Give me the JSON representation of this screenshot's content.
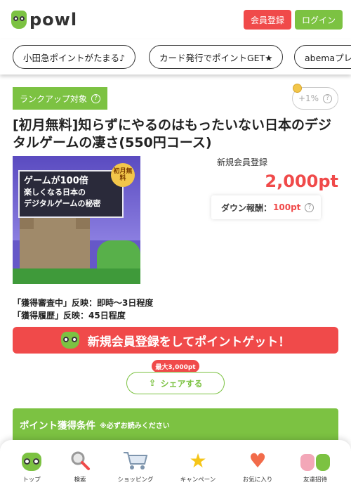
{
  "header": {
    "logo_text": "powl",
    "register_label": "会員登録",
    "login_label": "ログイン"
  },
  "chips": [
    "小田急ポイントがたまる♪",
    "カード発行でポイントGET★",
    "abemaプレ"
  ],
  "offer": {
    "rank_tag": "ランクアップ対象",
    "rate_badge": "+1%",
    "title": "[初月無料]知らずにやるのはもったいない日本のデジタルゲームの凄さ(550円コース)",
    "thumb_line1": "ゲームが100倍",
    "thumb_line2": "楽しくなる日本の",
    "thumb_line3": "デジタルゲームの秘密",
    "thumb_badge": "初月無料",
    "subhead": "新規会員登録",
    "points": "2,000pt",
    "down_label": "ダウン報酬：",
    "down_value": "100pt",
    "info_line1": "「獲得審査中」反映：即時〜3日程度",
    "info_line2": "「獲得履歴」反映：45日程度",
    "cta_label": "新規会員登録をしてポイントゲット！",
    "share_bubble": "最大3,000pt",
    "share_label": "シェアする",
    "conditions_title": "ポイント獲得条件",
    "conditions_note": "※必ずお読みください"
  },
  "tabbar": {
    "items": [
      {
        "label": "トップ",
        "icon": "owl-icon"
      },
      {
        "label": "検索",
        "icon": "search-icon"
      },
      {
        "label": "ショッピング",
        "icon": "cart-icon"
      },
      {
        "label": "キャンペーン",
        "icon": "star-icon"
      },
      {
        "label": "お気に入り",
        "icon": "heart-icon"
      },
      {
        "label": "友達招待",
        "icon": "friends-icon"
      }
    ]
  },
  "colors": {
    "brand_green": "#7cc242",
    "accent_red": "#f04a4a"
  }
}
